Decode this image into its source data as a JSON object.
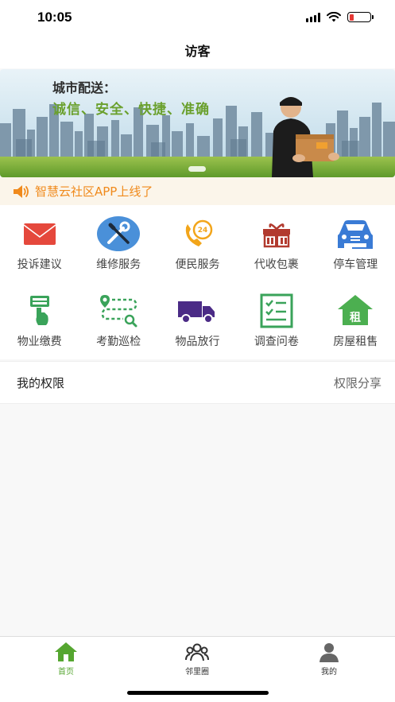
{
  "status_bar": {
    "time": "10:05",
    "battery_level": 0.22
  },
  "nav": {
    "title": "访客"
  },
  "banner": {
    "tagline": "城市配送：",
    "slogan": "诚信、安全、快捷、准确"
  },
  "notice": {
    "text": "智慧云社区APP上线了"
  },
  "services": [
    {
      "label": "投诉建议",
      "icon": "mail-icon",
      "color": "#e5483c"
    },
    {
      "label": "维修服务",
      "icon": "wrench-screwdriver-icon",
      "color": "#4a90d9"
    },
    {
      "label": "便民服务",
      "icon": "phone-24h-icon",
      "color": "#f2a51a"
    },
    {
      "label": "代收包裹",
      "icon": "gift-icon",
      "color": "#b23a2e"
    },
    {
      "label": "停车管理",
      "icon": "car-icon",
      "color": "#3a7bd5"
    },
    {
      "label": "物业缴费",
      "icon": "payment-terminal-icon",
      "color": "#3aa35a"
    },
    {
      "label": "考勤巡检",
      "icon": "route-search-icon",
      "color": "#3aa35a"
    },
    {
      "label": "物品放行",
      "icon": "truck-icon",
      "color": "#4b2b86"
    },
    {
      "label": "调查问卷",
      "icon": "checklist-icon",
      "color": "#3aa35a"
    },
    {
      "label": "房屋租售",
      "icon": "house-rent-icon",
      "color": "#4caf50",
      "badge": "租"
    }
  ],
  "permissions": {
    "title": "我的权限",
    "share_label": "权限分享"
  },
  "tab_bar": {
    "tabs": [
      {
        "label": "首页",
        "icon": "home-icon",
        "active": true
      },
      {
        "label": "邻里圈",
        "icon": "people-icon",
        "active": false
      },
      {
        "label": "我的",
        "icon": "profile-icon",
        "active": false
      }
    ]
  },
  "colors": {
    "accent_green": "#55a630",
    "notice_orange": "#f08a1c"
  }
}
